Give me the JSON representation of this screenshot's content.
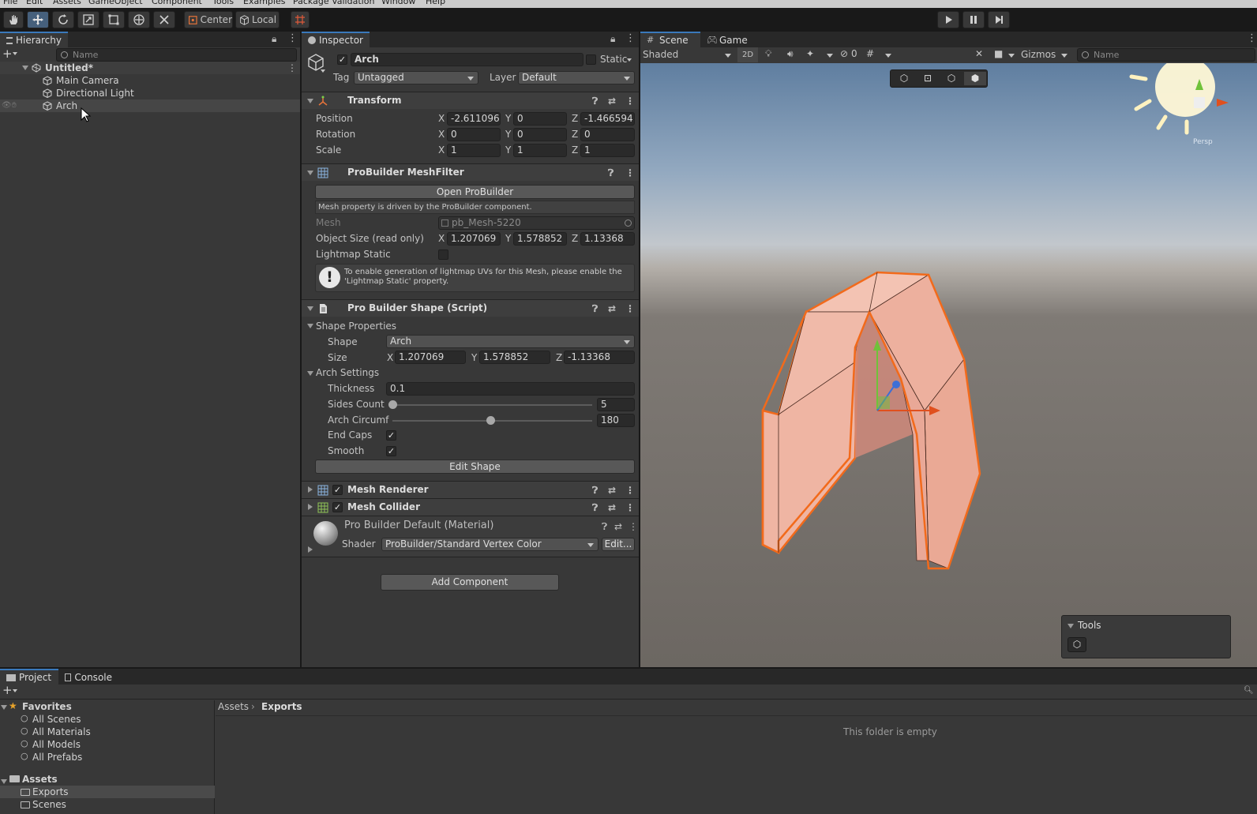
{
  "menubar": {
    "items": [
      "File",
      "Edit",
      "Assets",
      "GameObject",
      "Component",
      "Tools",
      "Examples",
      "Package Validation",
      "Window",
      "Help"
    ]
  },
  "toolbar": {
    "pivot_label": "Center",
    "space_label": "Local"
  },
  "hierarchy": {
    "tab_label": "Hierarchy",
    "search_placeholder": "Name",
    "scene_name": "Untitled*",
    "items": [
      "Main Camera",
      "Directional Light",
      "Arch"
    ]
  },
  "inspector": {
    "tab_label": "Inspector",
    "object_name": "Arch",
    "static_label": "Static",
    "tag_label": "Tag",
    "tag_value": "Untagged",
    "layer_label": "Layer",
    "layer_value": "Default",
    "transform": {
      "title": "Transform",
      "position_label": "Position",
      "rotation_label": "Rotation",
      "scale_label": "Scale",
      "position": {
        "x": "-2.611096",
        "y": "0",
        "z": "-1.466594"
      },
      "rotation": {
        "x": "0",
        "y": "0",
        "z": "0"
      },
      "scale": {
        "x": "1",
        "y": "1",
        "z": "1"
      }
    },
    "meshfilter": {
      "title": "ProBuilder MeshFilter",
      "open_button": "Open ProBuilder",
      "info": "Mesh property is driven by the ProBuilder component.",
      "mesh_label": "Mesh",
      "mesh_value": "pb_Mesh-5220",
      "object_size_label": "Object Size (read only)",
      "object_size": {
        "x": "1.207069",
        "y": "1.578852",
        "z": "1.13368"
      },
      "lightmap_label": "Lightmap Static",
      "warning": "To enable generation of lightmap UVs for this Mesh, please enable the 'Lightmap Static' property."
    },
    "shape": {
      "title": "Pro Builder Shape (Script)",
      "shape_properties_label": "Shape Properties",
      "shape_label": "Shape",
      "shape_value": "Arch",
      "size_label": "Size",
      "size": {
        "x": "1.207069",
        "y": "1.578852",
        "z": "-1.13368"
      },
      "arch_settings_label": "Arch Settings",
      "thickness_label": "Thickness",
      "thickness_value": "0.1",
      "sides_label": "Sides Count",
      "sides_value": "5",
      "sides_fraction": 0.0,
      "circum_label": "Arch Circumf",
      "circum_value": "180",
      "circum_fraction": 0.49,
      "endcaps_label": "End Caps",
      "smooth_label": "Smooth",
      "edit_button": "Edit Shape"
    },
    "mesh_renderer_title": "Mesh Renderer",
    "mesh_collider_title": "Mesh Collider",
    "material": {
      "title": "Pro Builder Default (Material)",
      "shader_label": "Shader",
      "shader_value": "ProBuilder/Standard Vertex Color",
      "edit_button": "Edit..."
    },
    "add_component": "Add Component"
  },
  "scene": {
    "tab_scene": "Scene",
    "tab_game": "Game",
    "shading": "Shaded",
    "mode_2d": "2D",
    "hidden_count": "0",
    "gizmos": "Gizmos",
    "search_placeholder": "Name",
    "tools_overlay_title": "Tools",
    "gizmo_label": "Persp",
    "colors": {
      "sky_top": "#5f7ea0",
      "ground": "#6c6762",
      "mesh_fill": "#f0b7a6",
      "outline": "#f26a1b"
    }
  },
  "project": {
    "tab_project": "Project",
    "tab_console": "Console",
    "favorites_label": "Favorites",
    "favorites": [
      "All Scenes",
      "All Materials",
      "All Models",
      "All Prefabs"
    ],
    "assets_label": "Assets",
    "asset_folders": [
      "Exports",
      "Scenes"
    ],
    "breadcrumb_root": "Assets",
    "breadcrumb_current": "Exports",
    "empty_message": "This folder is empty"
  }
}
